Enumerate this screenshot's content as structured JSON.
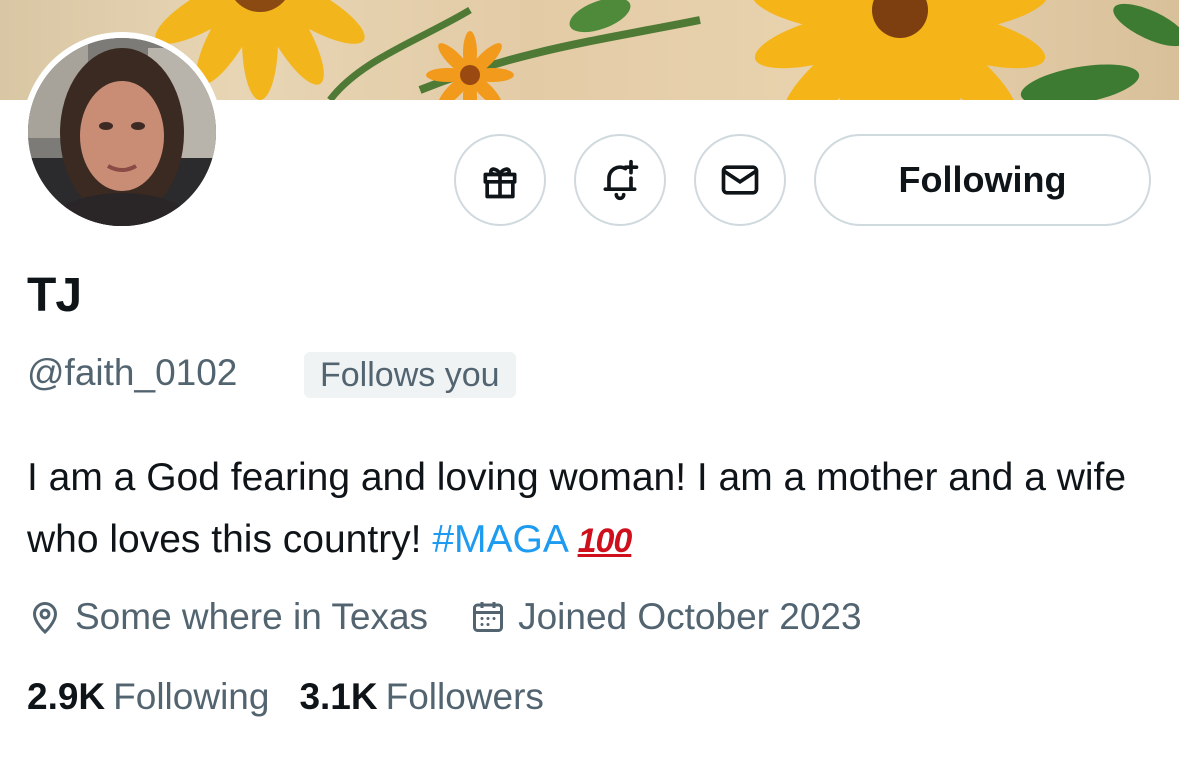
{
  "profile": {
    "display_name": "TJ",
    "handle": "@faith_0102",
    "follows_you_badge": "Follows you",
    "bio": {
      "text": "I am a God fearing and loving woman! I am a mother and a wife who loves this country! ",
      "hashtag": "#MAGA",
      "emoji": "100"
    },
    "location": "Some where in Texas",
    "joined": "Joined October 2023"
  },
  "actions": {
    "gift_icon": "gift-icon",
    "notify_icon": "bell-plus-icon",
    "message_icon": "envelope-icon",
    "follow_button_label": "Following"
  },
  "stats": {
    "following_count": "2.9K",
    "following_label": "Following",
    "followers_count": "3.1K",
    "followers_label": "Followers"
  },
  "colors": {
    "link": "#1d9bf0",
    "secondary_text": "#536471",
    "primary_text": "#0f1419",
    "border": "#cfd9de",
    "badge_bg": "#eff3f4"
  }
}
